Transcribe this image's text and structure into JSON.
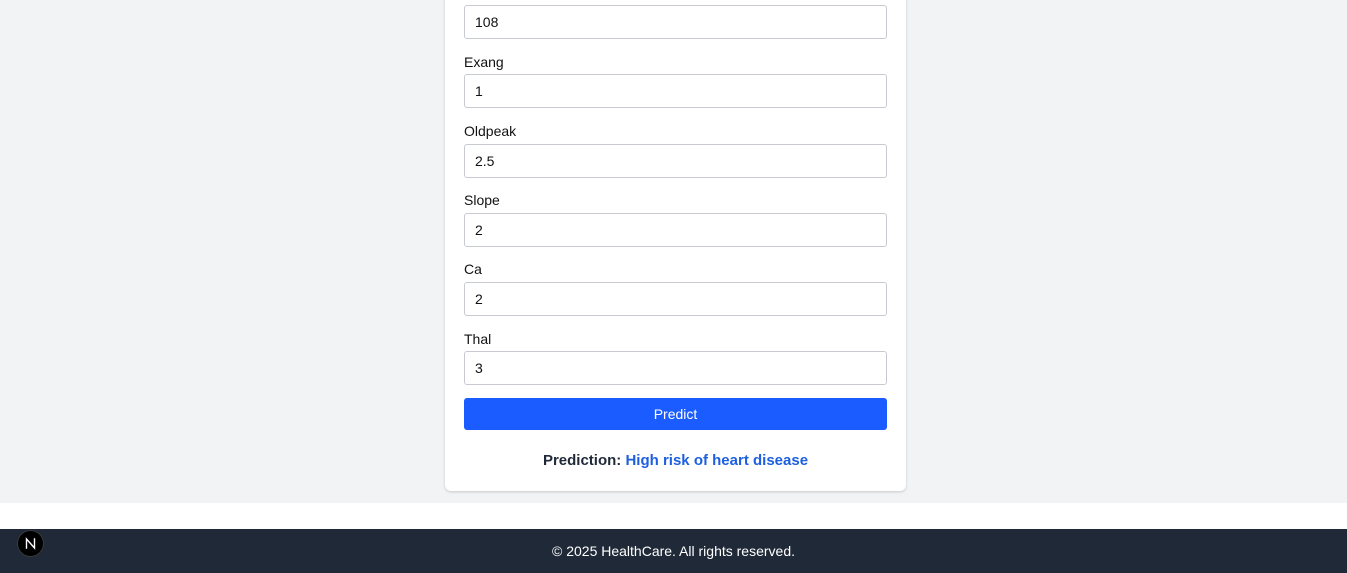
{
  "form": {
    "fields": [
      {
        "label": "",
        "value": "108"
      },
      {
        "label": "Exang",
        "value": "1"
      },
      {
        "label": "Oldpeak",
        "value": "2.5"
      },
      {
        "label": "Slope",
        "value": "2"
      },
      {
        "label": "Ca",
        "value": "2"
      },
      {
        "label": "Thal",
        "value": "3"
      }
    ],
    "predict_label": "Predict"
  },
  "result": {
    "label": "Prediction:",
    "value": "High risk of heart disease"
  },
  "footer": {
    "text": "© 2025 HealthCare. All rights reserved."
  },
  "badge": {
    "icon": "nextjs-logo-icon",
    "letter": "N"
  },
  "colors": {
    "background": "#f2f3f5",
    "button": "#1a5cff",
    "prediction_value": "#1d5fe0",
    "footer": "#1f2937"
  }
}
